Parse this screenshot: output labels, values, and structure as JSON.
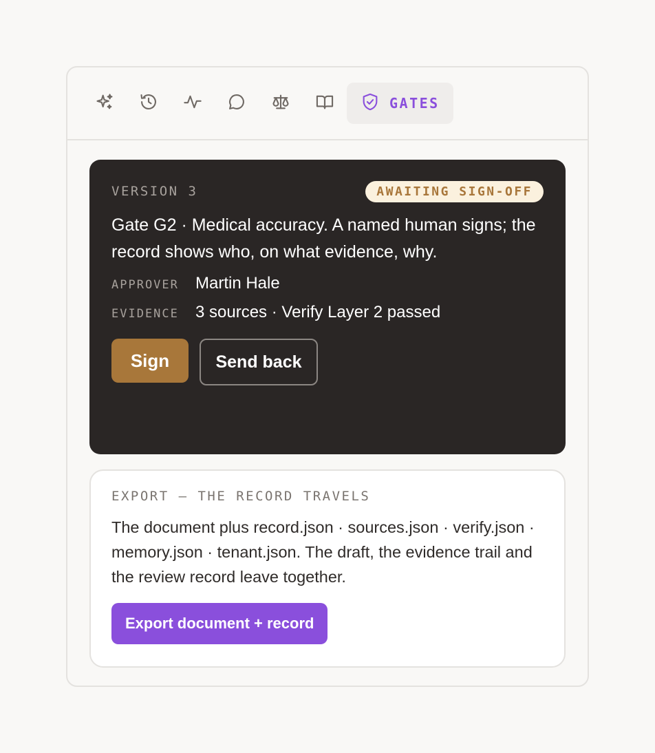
{
  "tabs": [
    {
      "icon": "sparkles-icon"
    },
    {
      "icon": "history-icon"
    },
    {
      "icon": "activity-icon"
    },
    {
      "icon": "chat-bubble-icon"
    },
    {
      "icon": "scale-icon"
    },
    {
      "icon": "book-icon"
    },
    {
      "icon": "shield-check-icon",
      "label": "GATES",
      "active": true
    }
  ],
  "gate": {
    "version_label": "VERSION 3",
    "status_badge": "AWAITING SIGN-OFF",
    "description": "Gate G2 · Medical accuracy. A named human signs; the record shows who, on what evidence, why.",
    "approver_key": "APPROVER",
    "approver_value": "Martin Hale",
    "evidence_key": "EVIDENCE",
    "evidence_value": "3 sources · Verify Layer 2 passed",
    "sign_label": "Sign",
    "send_back_label": "Send back"
  },
  "export": {
    "title": "EXPORT — THE RECORD TRAVELS",
    "description": "The document plus record.json · sources.json · verify.json · memory.json · tenant.json. The draft, the evidence trail and the review record leave together.",
    "button_label": "Export document + record"
  },
  "colors": {
    "accent": "#8a4fdc",
    "gold": "#a8773a",
    "dark_card": "#2a2625",
    "badge_bg": "#fbf1de"
  }
}
